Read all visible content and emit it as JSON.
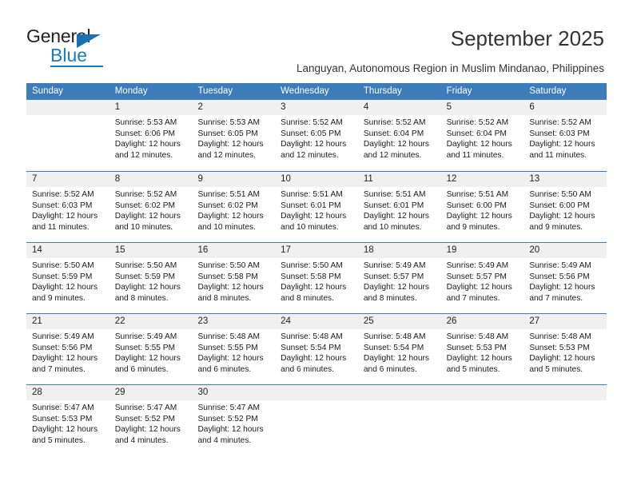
{
  "brand": {
    "name_part1": "General",
    "name_part2": "Blue"
  },
  "header": {
    "title": "September 2025",
    "subtitle": "Languyan, Autonomous Region in Muslim Mindanao, Philippines"
  },
  "colors": {
    "header_blue": "#3C7CB8",
    "daynum_band": "#F0F0F0",
    "brand_blue": "#1B7CC4",
    "text": "#222222"
  },
  "calendar": {
    "weekday_headers": [
      "Sunday",
      "Monday",
      "Tuesday",
      "Wednesday",
      "Thursday",
      "Friday",
      "Saturday"
    ],
    "weeks": [
      [
        {
          "day": "",
          "lines": []
        },
        {
          "day": "1",
          "lines": [
            "Sunrise: 5:53 AM",
            "Sunset: 6:06 PM",
            "Daylight: 12 hours",
            "and 12 minutes."
          ]
        },
        {
          "day": "2",
          "lines": [
            "Sunrise: 5:53 AM",
            "Sunset: 6:05 PM",
            "Daylight: 12 hours",
            "and 12 minutes."
          ]
        },
        {
          "day": "3",
          "lines": [
            "Sunrise: 5:52 AM",
            "Sunset: 6:05 PM",
            "Daylight: 12 hours",
            "and 12 minutes."
          ]
        },
        {
          "day": "4",
          "lines": [
            "Sunrise: 5:52 AM",
            "Sunset: 6:04 PM",
            "Daylight: 12 hours",
            "and 12 minutes."
          ]
        },
        {
          "day": "5",
          "lines": [
            "Sunrise: 5:52 AM",
            "Sunset: 6:04 PM",
            "Daylight: 12 hours",
            "and 11 minutes."
          ]
        },
        {
          "day": "6",
          "lines": [
            "Sunrise: 5:52 AM",
            "Sunset: 6:03 PM",
            "Daylight: 12 hours",
            "and 11 minutes."
          ]
        }
      ],
      [
        {
          "day": "7",
          "lines": [
            "Sunrise: 5:52 AM",
            "Sunset: 6:03 PM",
            "Daylight: 12 hours",
            "and 11 minutes."
          ]
        },
        {
          "day": "8",
          "lines": [
            "Sunrise: 5:52 AM",
            "Sunset: 6:02 PM",
            "Daylight: 12 hours",
            "and 10 minutes."
          ]
        },
        {
          "day": "9",
          "lines": [
            "Sunrise: 5:51 AM",
            "Sunset: 6:02 PM",
            "Daylight: 12 hours",
            "and 10 minutes."
          ]
        },
        {
          "day": "10",
          "lines": [
            "Sunrise: 5:51 AM",
            "Sunset: 6:01 PM",
            "Daylight: 12 hours",
            "and 10 minutes."
          ]
        },
        {
          "day": "11",
          "lines": [
            "Sunrise: 5:51 AM",
            "Sunset: 6:01 PM",
            "Daylight: 12 hours",
            "and 10 minutes."
          ]
        },
        {
          "day": "12",
          "lines": [
            "Sunrise: 5:51 AM",
            "Sunset: 6:00 PM",
            "Daylight: 12 hours",
            "and 9 minutes."
          ]
        },
        {
          "day": "13",
          "lines": [
            "Sunrise: 5:50 AM",
            "Sunset: 6:00 PM",
            "Daylight: 12 hours",
            "and 9 minutes."
          ]
        }
      ],
      [
        {
          "day": "14",
          "lines": [
            "Sunrise: 5:50 AM",
            "Sunset: 5:59 PM",
            "Daylight: 12 hours",
            "and 9 minutes."
          ]
        },
        {
          "day": "15",
          "lines": [
            "Sunrise: 5:50 AM",
            "Sunset: 5:59 PM",
            "Daylight: 12 hours",
            "and 8 minutes."
          ]
        },
        {
          "day": "16",
          "lines": [
            "Sunrise: 5:50 AM",
            "Sunset: 5:58 PM",
            "Daylight: 12 hours",
            "and 8 minutes."
          ]
        },
        {
          "day": "17",
          "lines": [
            "Sunrise: 5:50 AM",
            "Sunset: 5:58 PM",
            "Daylight: 12 hours",
            "and 8 minutes."
          ]
        },
        {
          "day": "18",
          "lines": [
            "Sunrise: 5:49 AM",
            "Sunset: 5:57 PM",
            "Daylight: 12 hours",
            "and 8 minutes."
          ]
        },
        {
          "day": "19",
          "lines": [
            "Sunrise: 5:49 AM",
            "Sunset: 5:57 PM",
            "Daylight: 12 hours",
            "and 7 minutes."
          ]
        },
        {
          "day": "20",
          "lines": [
            "Sunrise: 5:49 AM",
            "Sunset: 5:56 PM",
            "Daylight: 12 hours",
            "and 7 minutes."
          ]
        }
      ],
      [
        {
          "day": "21",
          "lines": [
            "Sunrise: 5:49 AM",
            "Sunset: 5:56 PM",
            "Daylight: 12 hours",
            "and 7 minutes."
          ]
        },
        {
          "day": "22",
          "lines": [
            "Sunrise: 5:49 AM",
            "Sunset: 5:55 PM",
            "Daylight: 12 hours",
            "and 6 minutes."
          ]
        },
        {
          "day": "23",
          "lines": [
            "Sunrise: 5:48 AM",
            "Sunset: 5:55 PM",
            "Daylight: 12 hours",
            "and 6 minutes."
          ]
        },
        {
          "day": "24",
          "lines": [
            "Sunrise: 5:48 AM",
            "Sunset: 5:54 PM",
            "Daylight: 12 hours",
            "and 6 minutes."
          ]
        },
        {
          "day": "25",
          "lines": [
            "Sunrise: 5:48 AM",
            "Sunset: 5:54 PM",
            "Daylight: 12 hours",
            "and 6 minutes."
          ]
        },
        {
          "day": "26",
          "lines": [
            "Sunrise: 5:48 AM",
            "Sunset: 5:53 PM",
            "Daylight: 12 hours",
            "and 5 minutes."
          ]
        },
        {
          "day": "27",
          "lines": [
            "Sunrise: 5:48 AM",
            "Sunset: 5:53 PM",
            "Daylight: 12 hours",
            "and 5 minutes."
          ]
        }
      ],
      [
        {
          "day": "28",
          "lines": [
            "Sunrise: 5:47 AM",
            "Sunset: 5:53 PM",
            "Daylight: 12 hours",
            "and 5 minutes."
          ]
        },
        {
          "day": "29",
          "lines": [
            "Sunrise: 5:47 AM",
            "Sunset: 5:52 PM",
            "Daylight: 12 hours",
            "and 4 minutes."
          ]
        },
        {
          "day": "30",
          "lines": [
            "Sunrise: 5:47 AM",
            "Sunset: 5:52 PM",
            "Daylight: 12 hours",
            "and 4 minutes."
          ]
        },
        {
          "day": "",
          "lines": []
        },
        {
          "day": "",
          "lines": []
        },
        {
          "day": "",
          "lines": []
        },
        {
          "day": "",
          "lines": []
        }
      ]
    ]
  }
}
